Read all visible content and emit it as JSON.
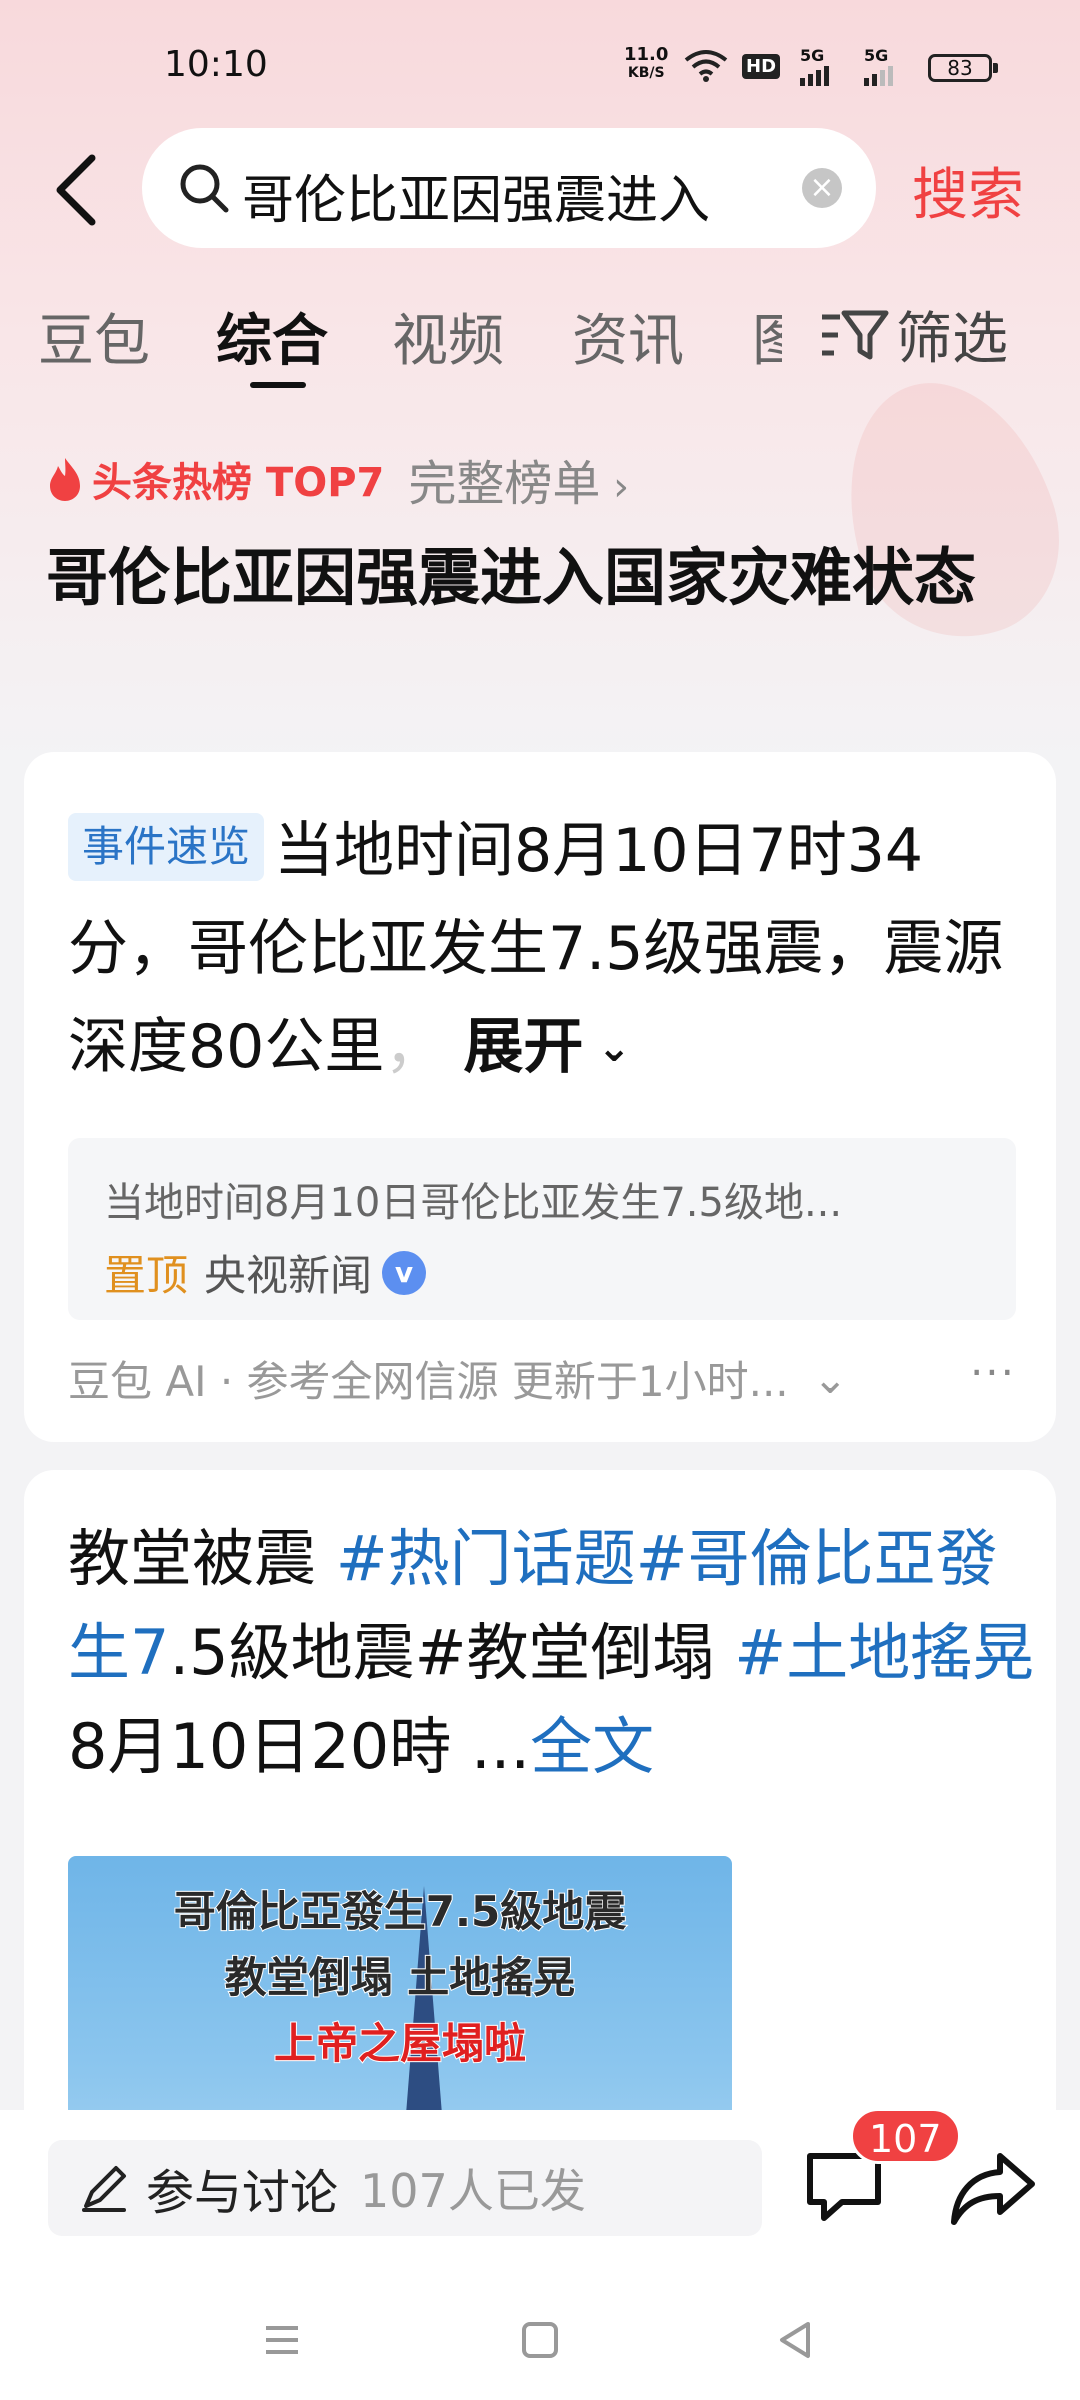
{
  "status_bar": {
    "time": "10:10",
    "net_speed_value": "11.0",
    "net_speed_unit": "KB/S",
    "hd_label": "HD",
    "signal_label_1": "5G",
    "signal_label_2": "5G",
    "battery": "83"
  },
  "search": {
    "query": "哥伦比亚因强震进入",
    "button_label": "搜索"
  },
  "tabs": {
    "items": [
      "豆包",
      "综合",
      "视频",
      "资讯"
    ],
    "active": "综合",
    "partial": "图",
    "filter_label": "筛选"
  },
  "hot": {
    "label": "头条热榜 TOP7",
    "more_label": "完整榜单",
    "headline": "哥伦比亚因强震进入国家灾难状态"
  },
  "summary_card": {
    "badge": "事件速览",
    "text": "当地时间8月10日7时34分，哥伦比亚发生7.5级强震，震源深度80公里",
    "expand_label": "展开",
    "ref_title": "当地时间8月10日哥伦比亚发生7.5级地...",
    "pin_label": "置顶",
    "source": "央视新闻",
    "footer": "豆包 AI · 参考全网信源 更新于1小时..."
  },
  "post_card": {
    "text_prefix": "教堂被震 ",
    "tag_1": "#热门话题#哥倫比亞發生7",
    "text_mid_1": ".5級地震#教堂倒塌 ",
    "tag_2": "#土地搖晃",
    "text_tail": " 8月10日20時 ...",
    "fulltext_label": "全文",
    "image_caption_1": "哥倫比亞發生7.5級地震",
    "image_caption_2": "教堂倒塌 土地搖晃",
    "image_caption_3": "上帝之屋塌啦"
  },
  "bottom_bar": {
    "discuss_label": "参与讨论",
    "discuss_count": "107人已发",
    "comment_badge": "107"
  }
}
